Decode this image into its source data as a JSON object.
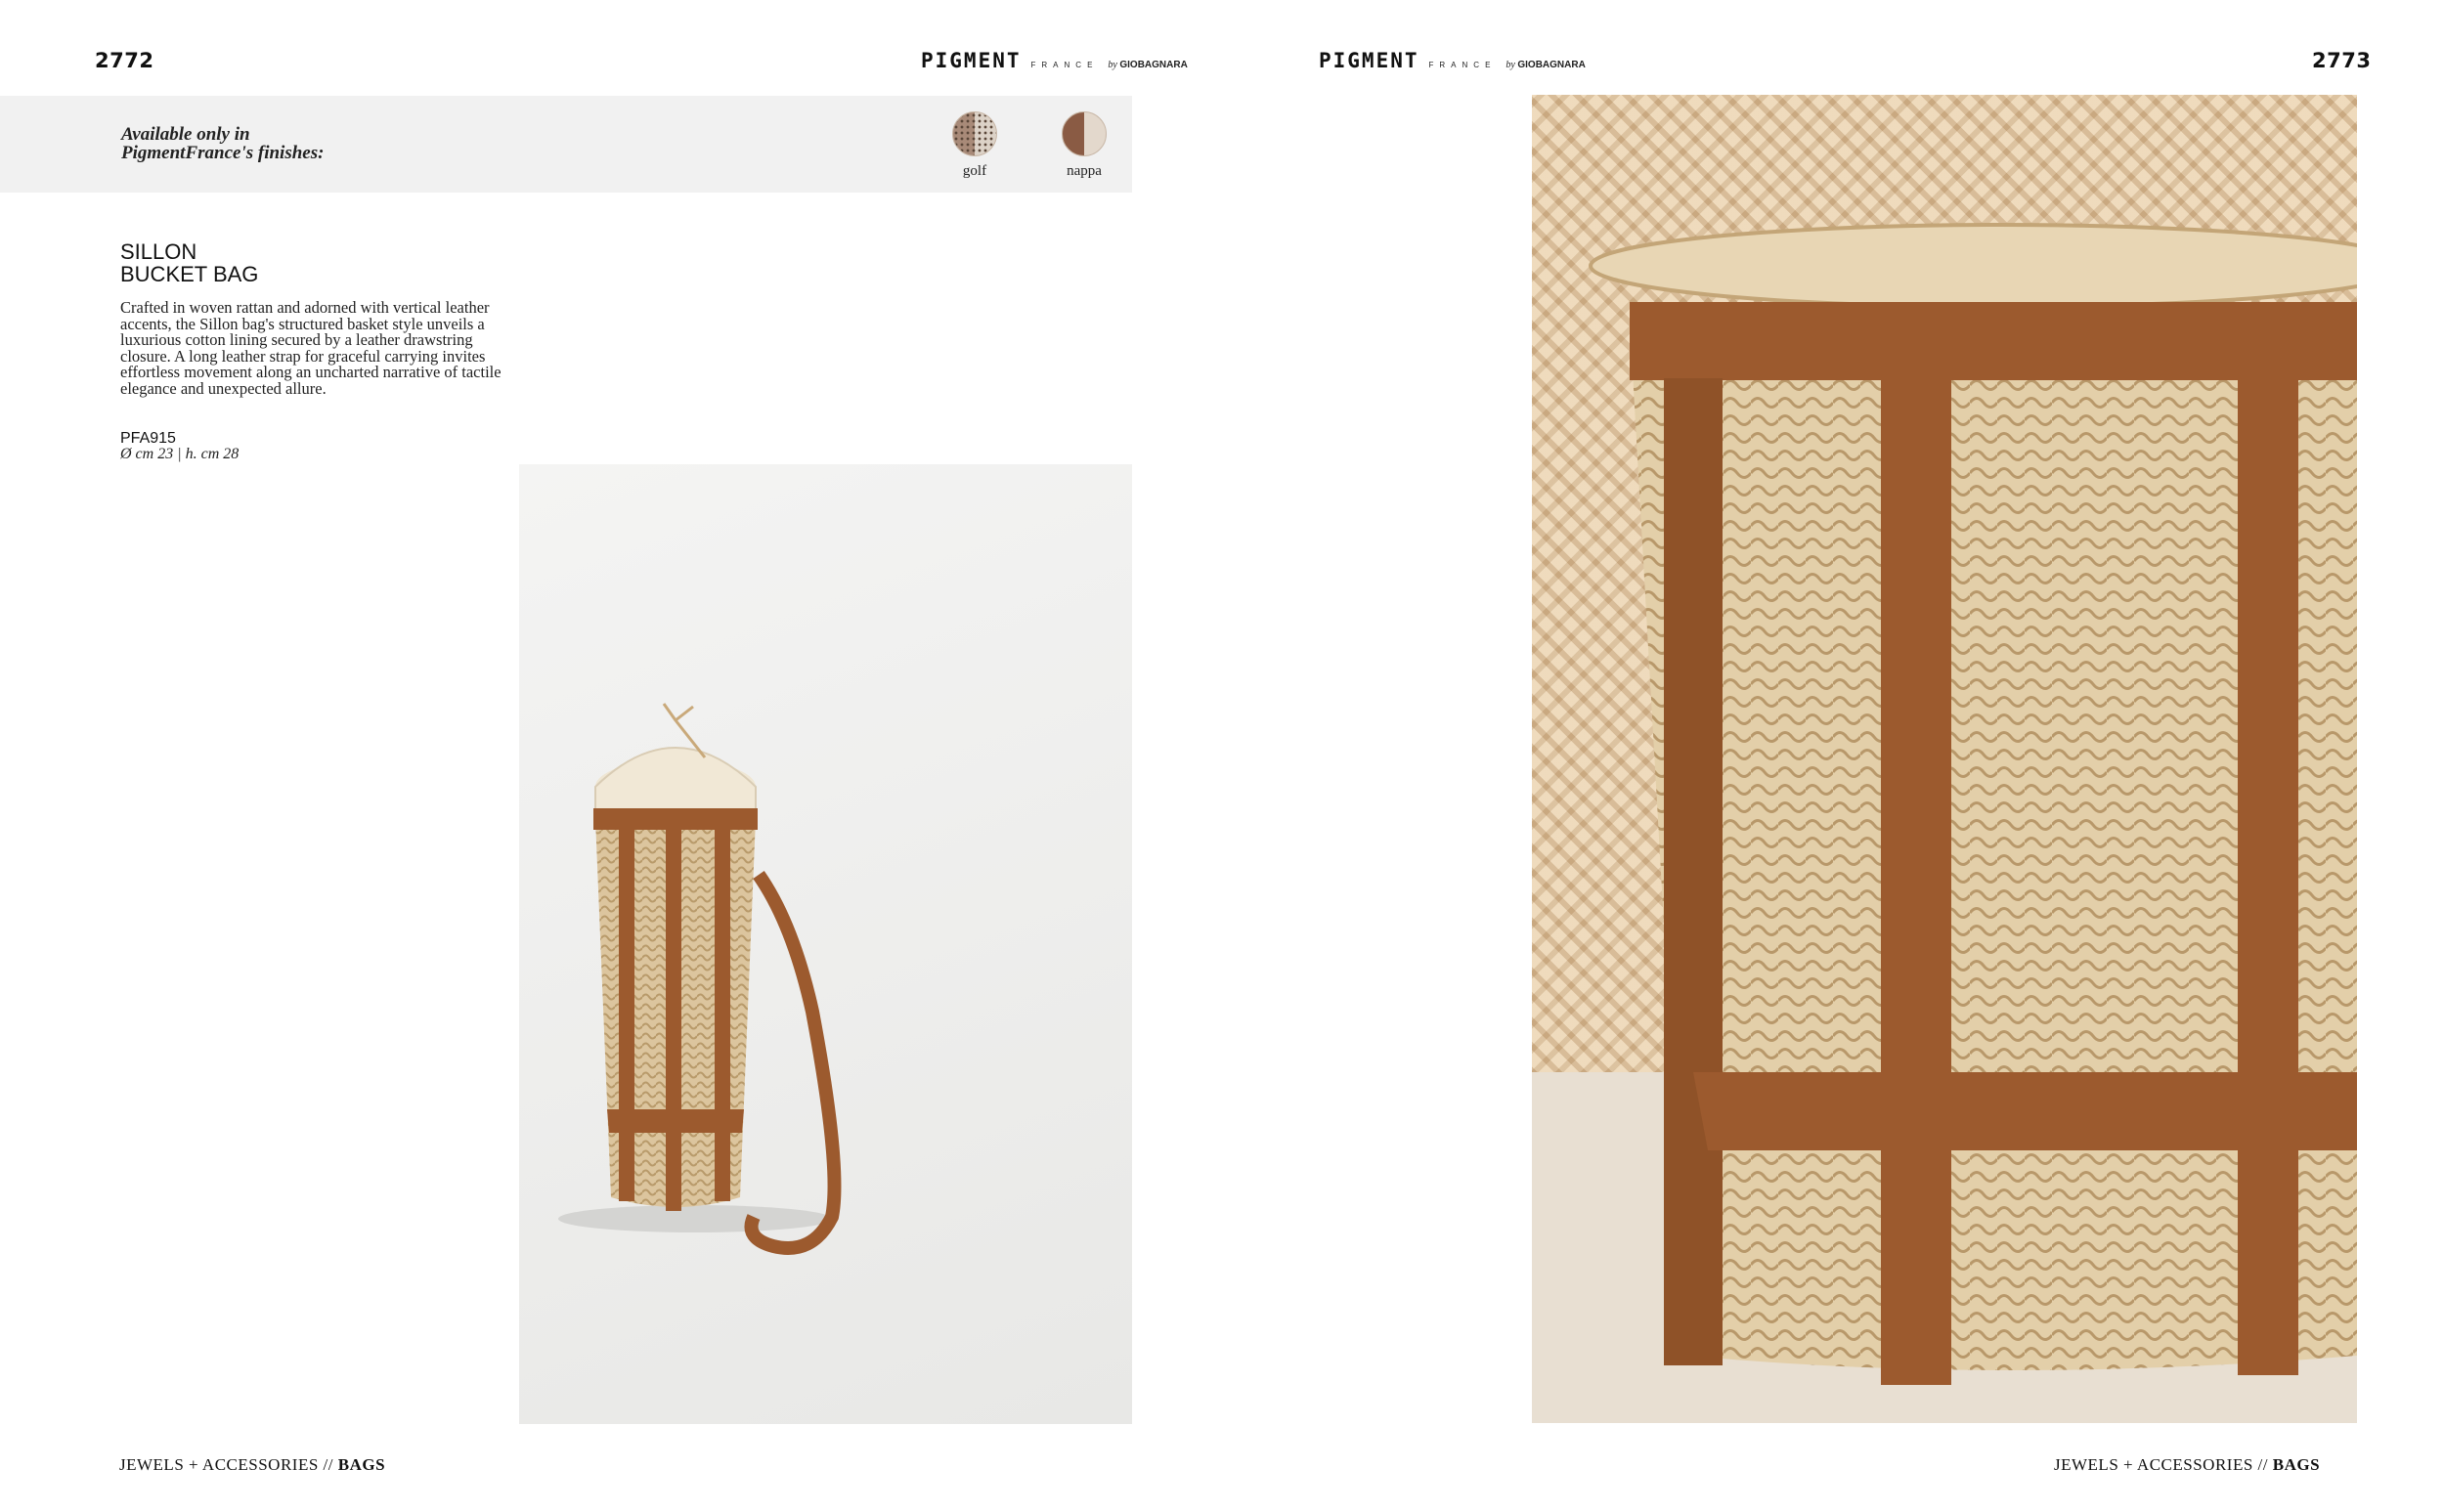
{
  "left_page": {
    "page_number": "2772",
    "brand": {
      "main": "PIGMENT",
      "sub": "FRANCE",
      "by": "by",
      "maker": "GIOBAGNARA"
    },
    "finishes": {
      "label_line1": "Available only in",
      "label_line2": "PigmentFrance's finishes:",
      "items": [
        {
          "label": "golf",
          "icon": "golf-leather-swatch-icon"
        },
        {
          "label": "nappa",
          "icon": "nappa-leather-swatch-icon"
        }
      ]
    },
    "product": {
      "title_line1": "SILLON",
      "title_line2": "BUCKET BAG",
      "description": "Crafted in woven rattan and adorned with vertical leather accents, the Sillon bag's structured basket style unveils a luxurious cotton lining secured by a leather drawstring closure. A long leather strap for graceful carrying invites effortless movement along an uncharted narrative of tactile elegance and unexpected allure.",
      "code": "PFA915",
      "dimensions": "Ø cm 23 | h. cm 28"
    },
    "footer": {
      "prefix": "JEWELS + ACCESSORIES //",
      "section": "BAGS"
    }
  },
  "right_page": {
    "page_number": "2773",
    "brand": {
      "main": "PIGMENT",
      "sub": "FRANCE",
      "by": "by",
      "maker": "GIOBAGNARA"
    },
    "footer": {
      "prefix": "JEWELS + ACCESSORIES //",
      "section": "BAGS"
    }
  },
  "colors": {
    "rattan": "#dcc59e",
    "leather": "#9c5a2e",
    "lining": "#efe6d3",
    "backdrop_wall": "#e6cfae"
  }
}
